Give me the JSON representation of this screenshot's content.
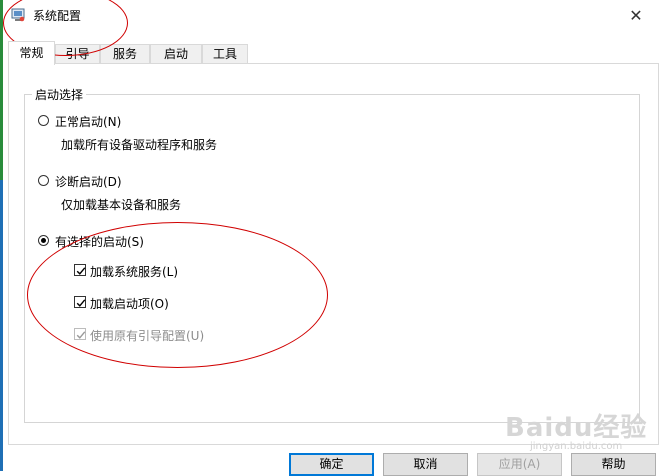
{
  "window": {
    "title": "系统配置",
    "close_glyph": "✕"
  },
  "tabs": [
    {
      "label": "常规",
      "active": true
    },
    {
      "label": "引导",
      "active": false
    },
    {
      "label": "服务",
      "active": false
    },
    {
      "label": "启动",
      "active": false
    },
    {
      "label": "工具",
      "active": false
    }
  ],
  "startup": {
    "group_label": "启动选择",
    "normal": {
      "label": "正常启动(N)",
      "desc": "加载所有设备驱动程序和服务",
      "selected": false
    },
    "diagnostic": {
      "label": "诊断启动(D)",
      "desc": "仅加载基本设备和服务",
      "selected": false
    },
    "selective": {
      "label": "有选择的启动(S)",
      "selected": true,
      "options": [
        {
          "label": "加载系统服务(L)",
          "checked": true,
          "enabled": true
        },
        {
          "label": "加载启动项(O)",
          "checked": true,
          "enabled": true
        },
        {
          "label": "使用原有引导配置(U)",
          "checked": true,
          "enabled": false
        }
      ]
    }
  },
  "buttons": {
    "ok": "确定",
    "cancel": "取消",
    "apply": "应用(A)",
    "help": "帮助"
  },
  "watermark": {
    "brand": "Baidu经验",
    "sub": "jingyan.baidu.com"
  },
  "colors": {
    "annotation": "#d00000",
    "accent": "#0078d7"
  }
}
